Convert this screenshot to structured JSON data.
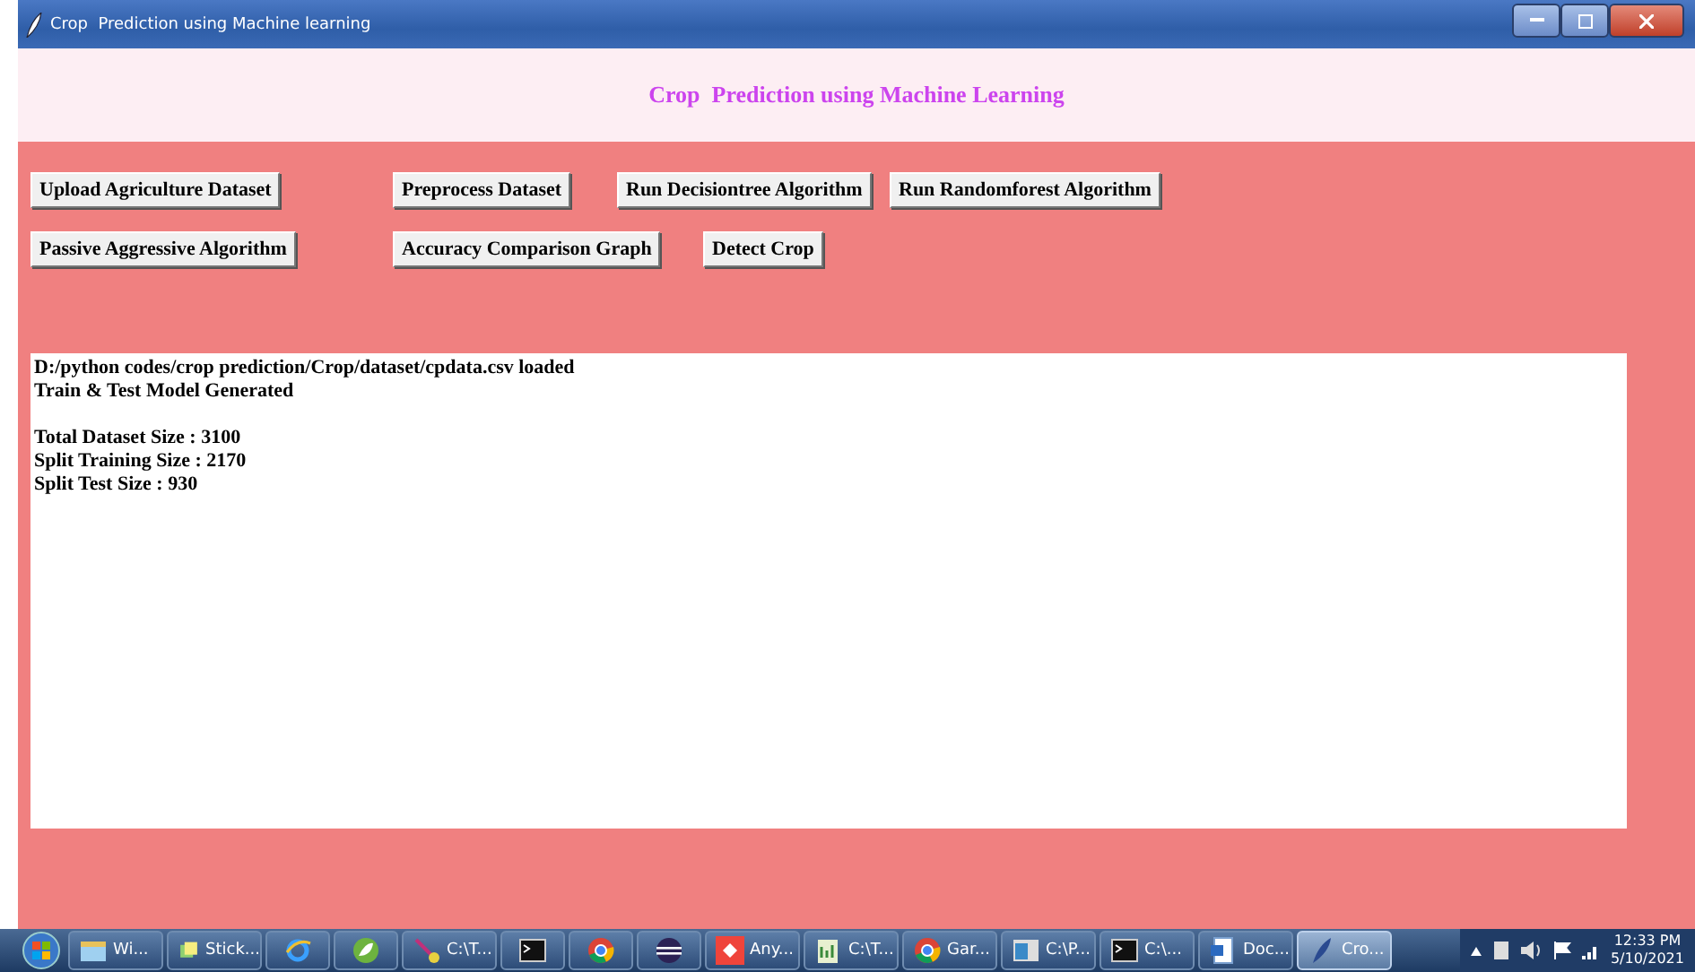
{
  "window": {
    "title": "Crop  Prediction using Machine learning"
  },
  "header": {
    "title": "Crop  Prediction using Machine Learning"
  },
  "button_rows": [
    [
      "Upload Agriculture Dataset",
      "Preprocess Dataset",
      "Run Decisiontree Algorithm",
      "Run Randomforest Algorithm"
    ],
    [
      "Passive Aggressive Algorithm",
      "Accuracy Comparison Graph",
      "Detect Crop"
    ]
  ],
  "output_paragraphs": [
    [
      "D:/python codes/crop prediction/Crop/dataset/cpdata.csv loaded",
      "Train & Test Model Generated"
    ],
    [
      "Total Dataset Size : 3100",
      "Split Training Size : 2170",
      "Split Test Size : 930"
    ]
  ],
  "taskbar": {
    "items": [
      {
        "kind": "labeled",
        "label": "Wi...",
        "selected": false
      },
      {
        "kind": "labeled",
        "label": "Stick...",
        "selected": false
      },
      {
        "kind": "icon",
        "selected": false
      },
      {
        "kind": "icon",
        "selected": false
      },
      {
        "kind": "labeled",
        "label": "C:\\T...",
        "selected": false
      },
      {
        "kind": "icon",
        "selected": false
      },
      {
        "kind": "icon",
        "selected": false
      },
      {
        "kind": "icon",
        "selected": false
      },
      {
        "kind": "labeled",
        "label": "Any...",
        "selected": false
      },
      {
        "kind": "labeled",
        "label": "C:\\T...",
        "selected": false
      },
      {
        "kind": "labeled",
        "label": "Gar...",
        "selected": false
      },
      {
        "kind": "labeled",
        "label": "C:\\P...",
        "selected": false
      },
      {
        "kind": "labeled",
        "label": "C:\\...",
        "selected": false
      },
      {
        "kind": "labeled",
        "label": "Doc...",
        "selected": false
      },
      {
        "kind": "labeled",
        "label": "Cro...",
        "selected": true
      }
    ],
    "time": "12:33 PM",
    "date": "5/10/2021"
  }
}
